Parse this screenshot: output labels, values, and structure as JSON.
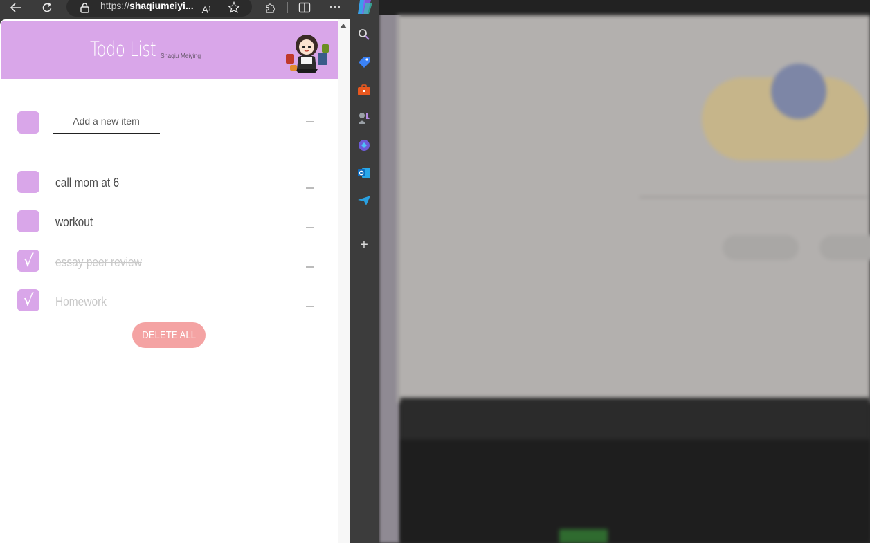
{
  "browser": {
    "url_prefix": "https://",
    "url_host": "shaqiumeiyi...",
    "icons": [
      "back-icon",
      "refresh-icon",
      "lock-icon",
      "read-aloud-icon",
      "favorite-star-icon",
      "extensions-icon",
      "split-screen-icon",
      "more-icon",
      "copilot-icon"
    ],
    "read_aloud_glyph": "A⁾",
    "more_glyph": "···"
  },
  "sidebar": {
    "icons": [
      "search-icon",
      "shopping-tag-icon",
      "tools-icon",
      "games-icon",
      "copilot-sidebar-icon",
      "outlook-icon",
      "send-icon",
      "add-icon"
    ],
    "add_glyph": "+"
  },
  "app": {
    "title": "Todo List",
    "author": "Shaqiu Meiying",
    "new_item_placeholder": "Add a new item",
    "delete_all_label": "DELETE ALL",
    "items": [
      {
        "text": "call mom at 6",
        "done": false
      },
      {
        "text": "workout",
        "done": false
      },
      {
        "text": "essay peer review",
        "done": true
      },
      {
        "text": "Homework",
        "done": true
      }
    ],
    "check_glyph": "√",
    "colors": {
      "header": "#d9a6e9",
      "checkbox": "#d9a6e9",
      "delete_button": "#f4a3a3",
      "done_text": "#c8c8c8"
    }
  }
}
